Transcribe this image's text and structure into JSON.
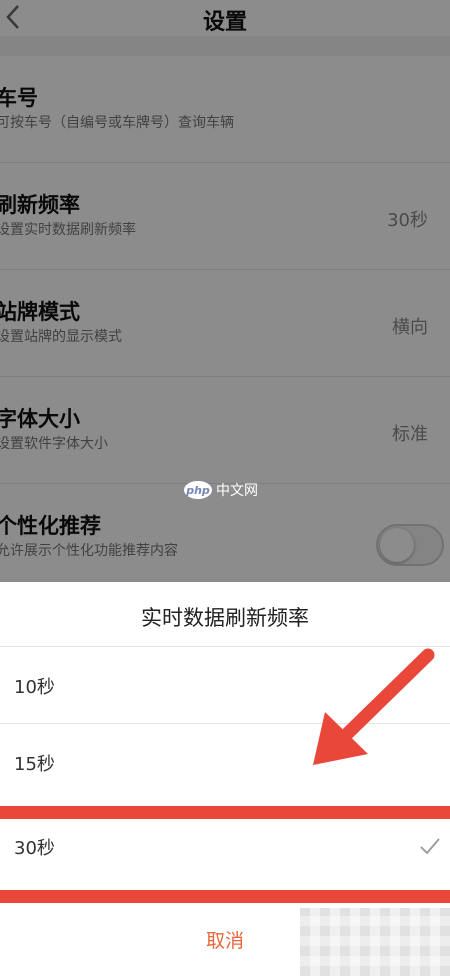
{
  "header": {
    "title": "设置",
    "back_icon": "chevron-left-icon"
  },
  "settings": [
    {
      "title": "车号",
      "subtitle": "可按车号（自编号或车牌号）查询车辆",
      "value": ""
    },
    {
      "title": "刷新频率",
      "subtitle": "设置实时数据刷新频率",
      "value": "30秒"
    },
    {
      "title": "站牌模式",
      "subtitle": "设置站牌的显示模式",
      "value": "横向"
    },
    {
      "title": "字体大小",
      "subtitle": "设置软件字体大小",
      "value": "标准"
    },
    {
      "title": "个性化推荐",
      "subtitle": "允许展示个性化功能推荐内容",
      "toggle": false
    }
  ],
  "watermark": {
    "badge": "php",
    "text": "中文网"
  },
  "sheet": {
    "title": "实时数据刷新频率",
    "options": [
      {
        "label": "10秒",
        "selected": false
      },
      {
        "label": "15秒",
        "selected": false
      },
      {
        "label": "30秒",
        "selected": true
      }
    ],
    "cancel_label": "取消"
  },
  "colors": {
    "accent": "#e8673a",
    "highlight": "#e8473a",
    "overlay": "rgba(0,0,0,0.45)"
  }
}
